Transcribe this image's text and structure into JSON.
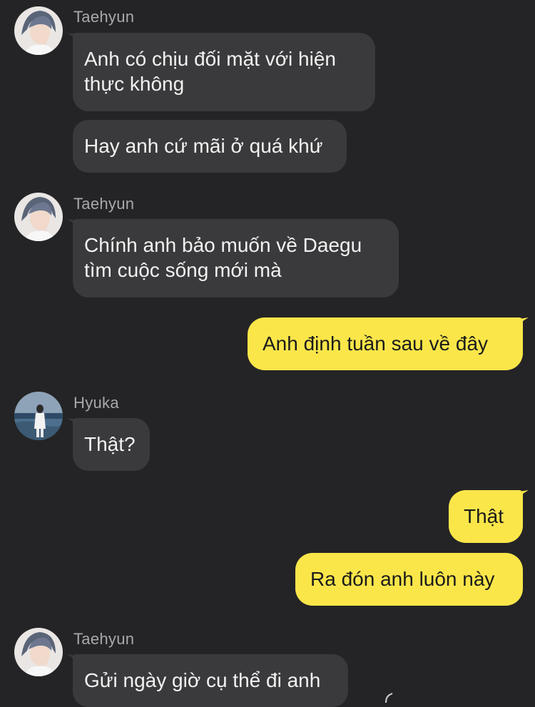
{
  "conversation": {
    "messages": [
      {
        "sender": "Taehyun",
        "text_lines": [
          "Anh có chịu đối mặt với hiện",
          "thực không"
        ]
      },
      {
        "sender": "Taehyun",
        "text_lines": [
          "Hay anh cứ mãi ở quá khứ"
        ]
      },
      {
        "sender": "Taehyun",
        "text_lines": [
          "Chính anh bảo muốn về Daegu",
          "tìm cuộc sống mới mà"
        ]
      },
      {
        "sender": "me",
        "text_lines": [
          "Anh định tuần sau về đây"
        ]
      },
      {
        "sender": "Hyuka",
        "text_lines": [
          "Thật?"
        ]
      },
      {
        "sender": "me",
        "text_lines": [
          "Thật"
        ]
      },
      {
        "sender": "me",
        "text_lines": [
          "Ra đón anh luôn này"
        ]
      },
      {
        "sender": "Taehyun",
        "text_lines": [
          "Gửi ngày giờ cụ thể đi anh"
        ]
      }
    ],
    "groups": [
      {
        "name": "Taehyun",
        "avatar": "taehyun-avatar-photo"
      },
      {
        "name": "Taehyun",
        "avatar": "taehyun-avatar-photo"
      },
      {
        "name": "Hyuka",
        "avatar": "hyuka-avatar-photo"
      },
      {
        "name": "Taehyun",
        "avatar": "taehyun-avatar-photo"
      }
    ]
  },
  "colors": {
    "background": "#242426",
    "incoming_bubble": "#3a3a3c",
    "outgoing_bubble": "#fbe64a",
    "sender_name": "#a9a9ad"
  }
}
